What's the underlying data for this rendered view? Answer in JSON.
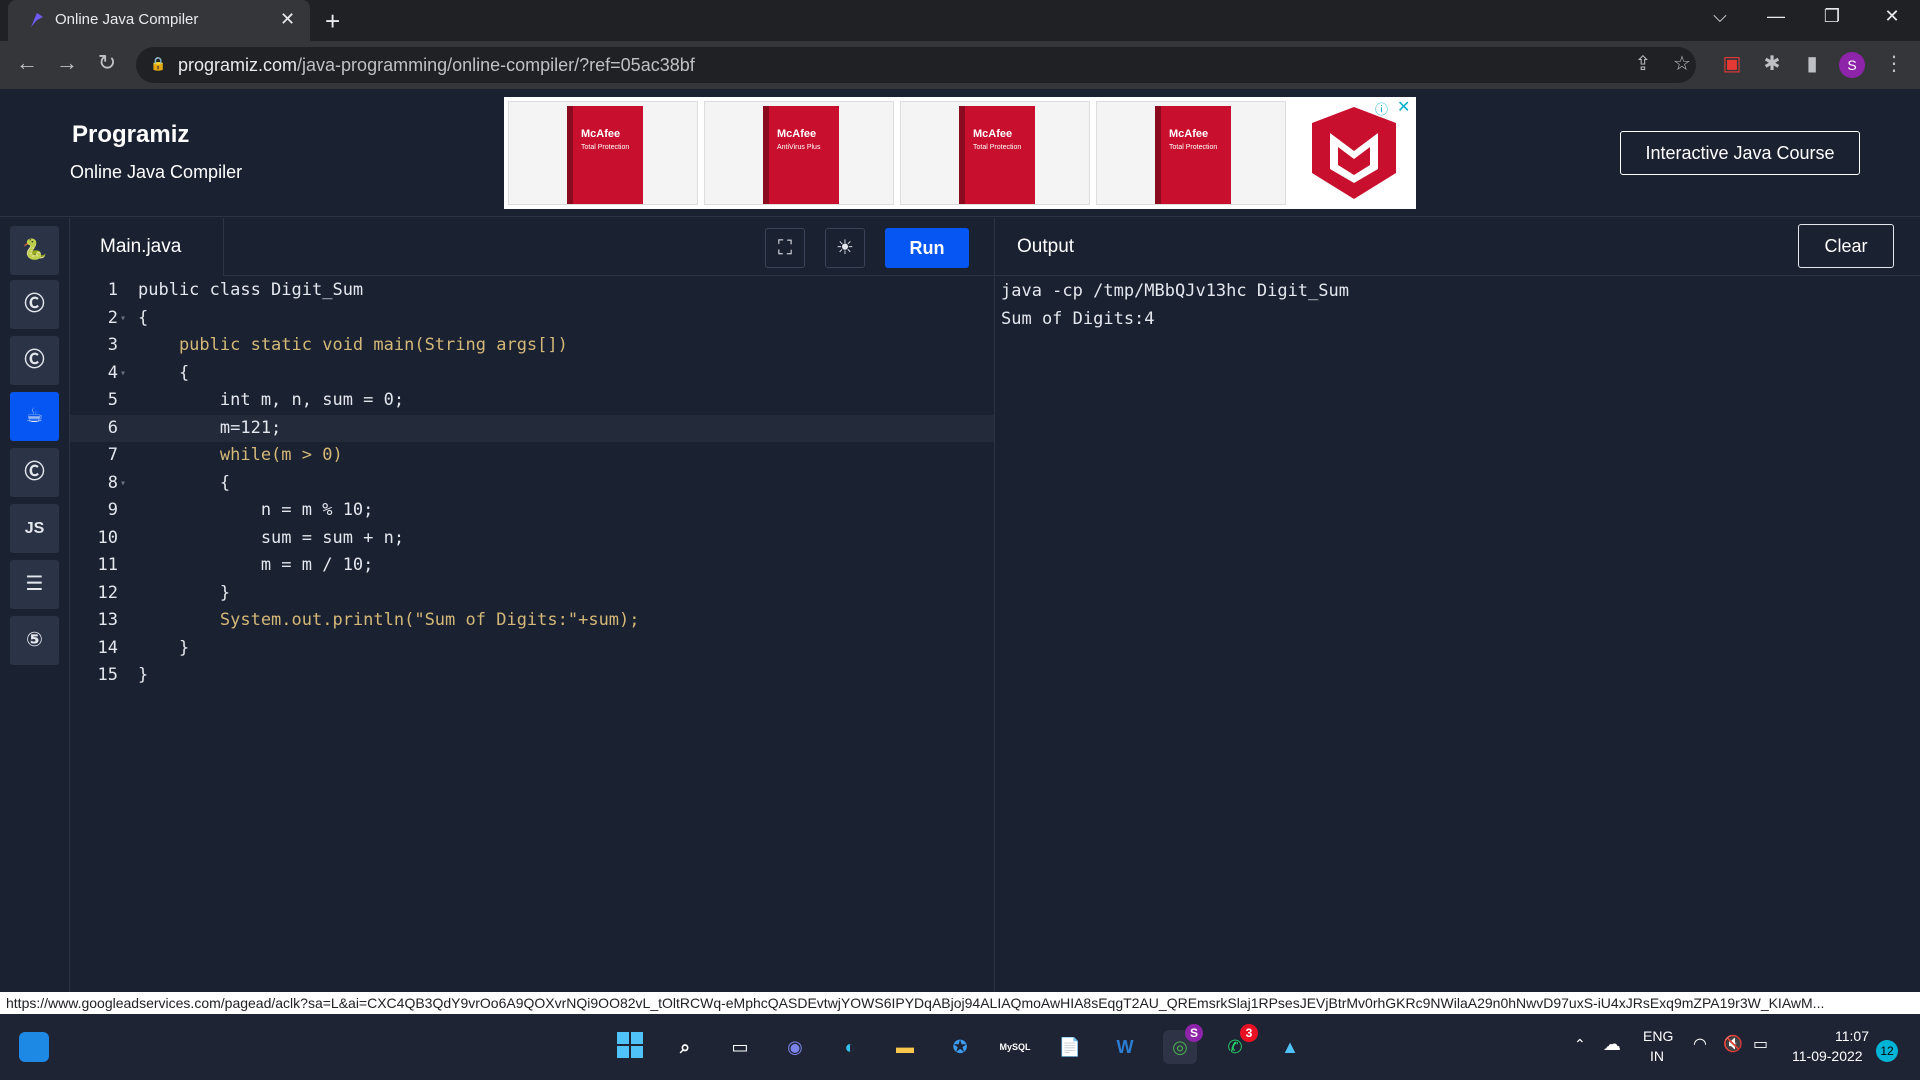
{
  "browser": {
    "tab_title": "Online Java Compiler",
    "tab_close": "✕",
    "new_tab": "+",
    "url_host": "programiz.com",
    "url_path": "/java-programming/online-compiler/?ref=05ac38bf",
    "profile_initial": "S"
  },
  "site": {
    "logo": "Programiz",
    "subtitle": "Online Java Compiler",
    "course_button": "Interactive Java Course",
    "ad_brand": "McAfee",
    "ad_products": [
      "Total Protection",
      "AntiVirus Plus",
      "Total Protection",
      "Total Protection"
    ]
  },
  "languages": [
    "Python",
    "C",
    "C++",
    "Java",
    "C#",
    "JS",
    "SQL",
    "HTML"
  ],
  "languages_active": "Java",
  "editor": {
    "filename": "Main.java",
    "run_label": "Run",
    "lines": [
      "public class Digit_Sum",
      "{",
      "    public static void main(String args[])",
      "    {",
      "        int m, n, sum = 0;",
      "        m=121;",
      "        while(m > 0)",
      "        {",
      "            n = m % 10;",
      "            sum = sum + n;",
      "            m = m / 10;",
      "        }",
      "        System.out.println(\"Sum of Digits:\"+sum);",
      "    }",
      "}"
    ],
    "line_numbers": [
      "1",
      "2",
      "3",
      "4",
      "5",
      "6",
      "7",
      "8",
      "9",
      "10",
      "11",
      "12",
      "13",
      "14",
      "15"
    ]
  },
  "output": {
    "title": "Output",
    "clear_label": "Clear",
    "lines": [
      "java -cp /tmp/MBbQJv13hc Digit_Sum",
      "Sum of Digits:4"
    ]
  },
  "status_url": "https://www.googleadservices.com/pagead/aclk?sa=L&ai=CXC4QB3QdY9vrOo6A9QOXvrNQi9OO82vL_tOltRCWq-eMphcQASDEvtwjYOWS6IPYDqABjoj94ALIAQmoAwHIA8sEqgT2AU_QREmsrkSlaj1RPsesJEVjBtrMv0rhGKRc9NWilaA29n0hNwvD97uxS-iU4xJRsExq9mZPA19r3W_KIAwM...",
  "taskbar": {
    "lang_top": "ENG",
    "lang_bottom": "IN",
    "time": "11:07",
    "date": "11-09-2022",
    "notif_count": "12",
    "whatsapp_badge": "3",
    "chrome_badge": "S"
  },
  "colors": {
    "accent": "#0556f3",
    "background": "#1a2130",
    "keyword": "#d4b878",
    "number": "#e06c5b"
  }
}
